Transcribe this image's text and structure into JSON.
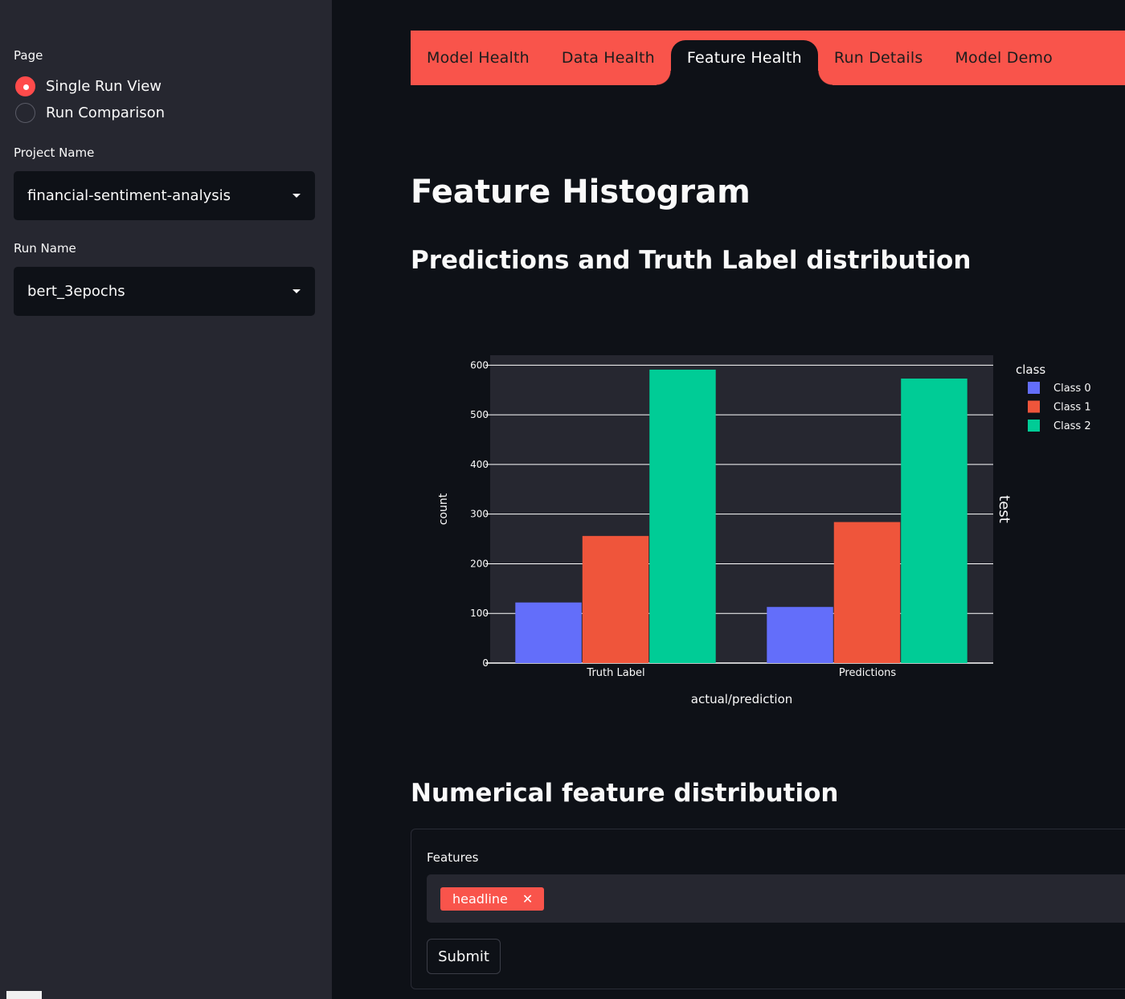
{
  "sidebar": {
    "page_label": "Page",
    "page_options": [
      {
        "label": "Single Run View",
        "selected": true
      },
      {
        "label": "Run Comparison",
        "selected": false
      }
    ],
    "project_label": "Project Name",
    "project_value": "financial-sentiment-analysis",
    "run_label": "Run Name",
    "run_value": "bert_3epochs"
  },
  "tabs": [
    {
      "label": "Model Health",
      "active": false
    },
    {
      "label": "Data Health",
      "active": false
    },
    {
      "label": "Feature Health",
      "active": true
    },
    {
      "label": "Run Details",
      "active": false
    },
    {
      "label": "Model Demo",
      "active": false
    }
  ],
  "main": {
    "title": "Feature Histogram",
    "section1": "Predictions and Truth Label distribution",
    "section2": "Numerical feature distribution",
    "form": {
      "features_label": "Features",
      "selected_tags": [
        "headline"
      ],
      "submit_label": "Submit"
    }
  },
  "colors": {
    "accent": "#f9544b",
    "class0": "#636efa",
    "class1": "#ef553b",
    "class2": "#00cc96"
  },
  "chart_data": {
    "type": "bar",
    "categories": [
      "Truth Label",
      "Predictions"
    ],
    "series": [
      {
        "name": "Class 0",
        "values": [
          122,
          113
        ]
      },
      {
        "name": "Class 1",
        "values": [
          256,
          284
        ]
      },
      {
        "name": "Class 2",
        "values": [
          591,
          573
        ]
      }
    ],
    "xlabel": "actual/prediction",
    "ylabel": "count",
    "ylim": [
      0,
      620
    ],
    "yticks": [
      0,
      100,
      200,
      300,
      400,
      500,
      600
    ],
    "legend_title": "class",
    "legend_position": "top-right",
    "facet_label": "test",
    "grid": true
  }
}
